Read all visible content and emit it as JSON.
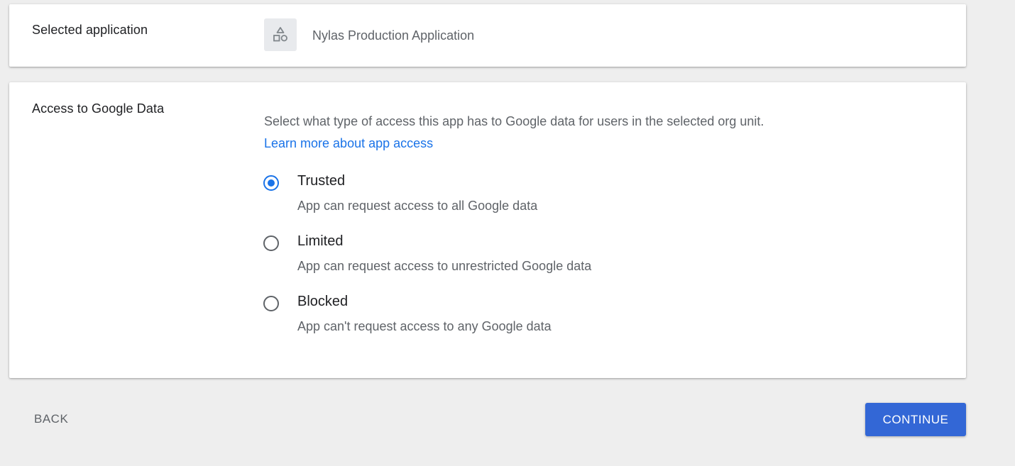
{
  "selected_app": {
    "label": "Selected application",
    "icon": "shapes-icon",
    "app_name": "Nylas Production Application"
  },
  "access": {
    "label": "Access to Google Data",
    "description": "Select what type of access this app has to Google data for users in the selected org unit.",
    "learn_more": "Learn more about app access",
    "selected": "trusted",
    "options": [
      {
        "id": "trusted",
        "title": "Trusted",
        "subtitle": "App can request access to all Google data"
      },
      {
        "id": "limited",
        "title": "Limited",
        "subtitle": "App can request access to unrestricted Google data"
      },
      {
        "id": "blocked",
        "title": "Blocked",
        "subtitle": "App can't request access to any Google data"
      }
    ]
  },
  "footer": {
    "back_label": "BACK",
    "continue_label": "CONTINUE"
  },
  "colors": {
    "accent": "#1a73e8",
    "primary_button": "#3367d6",
    "background": "#eeeeee"
  }
}
